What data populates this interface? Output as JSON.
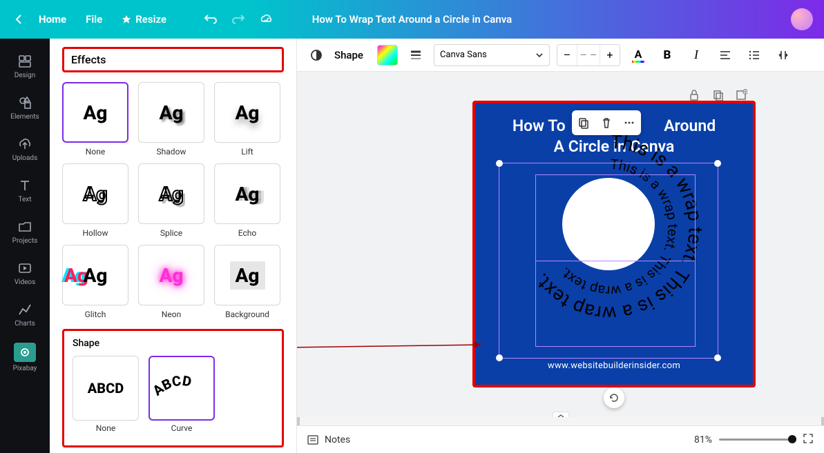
{
  "header": {
    "home_label": "Home",
    "file_label": "File",
    "resize_label": "Resize",
    "doc_title": "How To Wrap Text Around a Circle in Canva"
  },
  "rail": {
    "items": [
      "Design",
      "Elements",
      "Uploads",
      "Text",
      "Projects",
      "Videos",
      "Charts",
      "Pixabay"
    ]
  },
  "effects_panel": {
    "title": "Effects",
    "styles": [
      {
        "name": "None"
      },
      {
        "name": "Shadow"
      },
      {
        "name": "Lift"
      },
      {
        "name": "Hollow"
      },
      {
        "name": "Splice"
      },
      {
        "name": "Echo"
      },
      {
        "name": "Glitch"
      },
      {
        "name": "Neon"
      },
      {
        "name": "Background"
      }
    ],
    "sample": "Ag",
    "shape_title": "Shape",
    "shape_sample": "ABCD",
    "shape_options": [
      {
        "name": "None"
      },
      {
        "name": "Curve"
      }
    ]
  },
  "toolbar": {
    "shape_label": "Shape",
    "font_name": "Canva Sans",
    "font_size": "– –",
    "text_color_letter": "A",
    "bold_letter": "B",
    "italic_letter": "I"
  },
  "canvas": {
    "heading_line1_before": "How To",
    "heading_line1_after": "Around",
    "heading_line2": "A Circle in Canva",
    "wrap_text_outer": "This is a wrap text. This is a wrap text.",
    "wrap_text_inner": "This is a wrap text. This is a wrap text.",
    "footer": "www.websitebuilderinsider.com"
  },
  "bottom": {
    "notes_label": "Notes",
    "zoom_label": "81%"
  }
}
